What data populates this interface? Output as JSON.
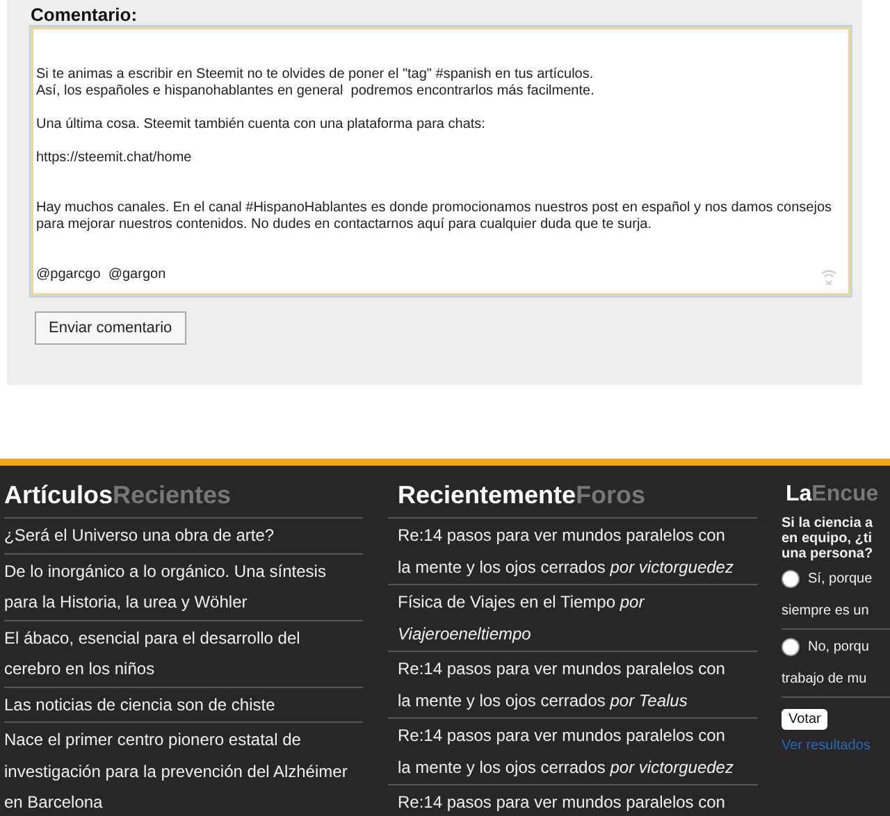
{
  "comment_form": {
    "label": "Comentario:",
    "value": "\n\nSi te animas a escribir en Steemit no te olvides de poner el \"tag\" #spanish en tus artículos.\nAsí, los españoles e hispanohablantes en general  podremos encontrarlos más facilmente.\n\nUna última cosa. Steemit también cuenta con una plataforma para chats:\n\nhttps://steemit.chat/home\n\n\nHay muchos canales. En el canal #HispanoHablantes es donde promocionamos nuestros post en español y nos damos consejos para mejorar nuestros contenidos. No dudes en contactarnos aquí para cualquier duda que te surja.\n\n\n@pgarcgo  @gargon",
    "submit": "Enviar comentario"
  },
  "recent_articles": {
    "title_main": "Artículos",
    "title_sub": "Recientes",
    "items": [
      {
        "text": "¿Será el Universo una obra de arte?"
      },
      {
        "text": "De lo inorgánico a lo orgánico. Una síntesis para la Historia, la urea y Wöhler"
      },
      {
        "text": "El ábaco, esencial para el desarrollo del cerebro en los niños"
      },
      {
        "text": "Las noticias de ciencia son de chiste"
      },
      {
        "text": "Nace el primer centro pionero estatal de investigación para la prevención del Alzhéimer en Barcelona"
      }
    ]
  },
  "recent_forums": {
    "title_main": "Recientemente",
    "title_sub": "Foros",
    "items": [
      {
        "text": "Re:14 pasos para ver mundos paralelos con la mente y los ojos cerrados *por victorguedez*"
      },
      {
        "text": "Física de Viajes en el Tiempo *por Viajeroeneltiempo*"
      },
      {
        "text": "Re:14 pasos para ver mundos paralelos con la mente y los ojos cerrados *por Tealus*"
      },
      {
        "text": "Re:14 pasos para ver mundos paralelos con la mente y los ojos cerrados *por victorguedez*"
      },
      {
        "text": "Re:14 pasos para ver mundos paralelos con"
      }
    ]
  },
  "poll": {
    "title_main": "La",
    "title_sub": "Encue",
    "question_lines": [
      "Si la ciencia a",
      "en equipo, ¿ti",
      "una persona?"
    ],
    "options": [
      {
        "lines": [
          "Sí, porque",
          "siempre es un"
        ],
        "selected": false
      },
      {
        "lines": [
          "No, porqu",
          "trabajo de mu"
        ],
        "selected": false
      }
    ],
    "vote": "Votar",
    "results_link": "Ver resultados"
  }
}
